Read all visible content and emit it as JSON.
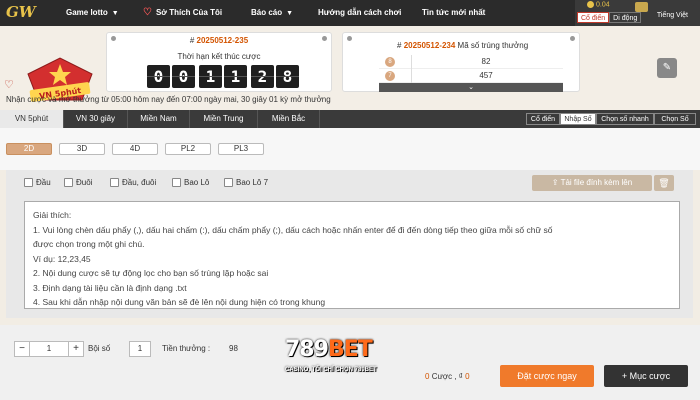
{
  "topnav": {
    "logo": "GW",
    "items": [
      {
        "label": "Game lotto",
        "chevron": true
      },
      {
        "label": "Sở Thích Của Tôi",
        "chevron": false
      },
      {
        "label": "Báo cáo",
        "chevron": true
      },
      {
        "label": "Hướng dẫn cách chơi",
        "chevron": false
      },
      {
        "label": "Tin tức mới nhất",
        "chevron": false
      }
    ],
    "balance": "0.04",
    "ui_modes": [
      "Cổ điển",
      "Di động"
    ],
    "language": "Tiếng Việt"
  },
  "header": {
    "game_badge": "VN 5phút",
    "countdown": {
      "draw_prefix": "#",
      "draw_number": "20250512-235",
      "label": "Thời hạn kết thúc cược",
      "digits": [
        "0",
        "0",
        "1",
        "1",
        "2",
        "8"
      ]
    },
    "result": {
      "draw_prefix": "#",
      "draw_number": "20250512-234",
      "label": "Mã số trúng thưởng",
      "rows": [
        {
          "badge": "8",
          "value": "82"
        },
        {
          "badge": "7",
          "value": "457"
        }
      ]
    },
    "notice": "Nhận cược và mở thưởng từ 05:00 hôm nay đến 07:00 ngày mai,   30 giây 01 kỳ mở thưởng"
  },
  "tabs": {
    "items": [
      "VN 5phút",
      "VN 30 giây",
      "Miền Nam",
      "Miền Trung",
      "Miền Bắc"
    ],
    "active": 0,
    "modes": [
      "Cổ điển",
      "Nhập Số",
      "Chọn số nhanh",
      "Chọn Số"
    ],
    "active_mode": 1
  },
  "subtabs": {
    "items": [
      "2D",
      "3D",
      "4D",
      "PL2",
      "PL3"
    ],
    "active": 0
  },
  "options": {
    "checkboxes": [
      "Đầu",
      "Đuôi",
      "Đầu, đuôi",
      "Bao Lô",
      "Bao Lô 7"
    ],
    "upload_label": "Tải file đính kèm lên"
  },
  "instructions": [
    "Giải thích:",
    "1. Vui lòng chèn dấu phẩy (,), dấu hai chấm (:), dấu chấm phẩy (;), dấu cách hoặc nhấn enter để đi đến dòng tiếp theo giữa mỗi số chữ số",
    "được chọn trong một ghi chú.",
    "Ví dụ: 12,23,45",
    "2. Nội dung cược sẽ tự động lọc cho bạn số trùng lặp hoặc sai",
    "3. Định dạng tài liệu cần là định dạng .txt",
    "4. Sau khi dẫn nhập nội dung văn bản sẽ đè lên nội dung hiện có trong khung"
  ],
  "bottom": {
    "stepper_value": "1",
    "multiplier_label": "Bội số",
    "multiplier_value": "1",
    "prize_label": "Tiền thưởng :",
    "prize_value": "98",
    "watermark_main": "789",
    "watermark_accent": "BET",
    "watermark_sub": "CASINO, TÔI CHỈ CHỌN 789BET",
    "bet_count": "0",
    "bet_count_label": "Cược ,",
    "bet_amount_prefix": "₫",
    "bet_amount": "0",
    "place_bet_label": "Đặt cược ngay",
    "bet_list_label": "+ Mục cược"
  }
}
